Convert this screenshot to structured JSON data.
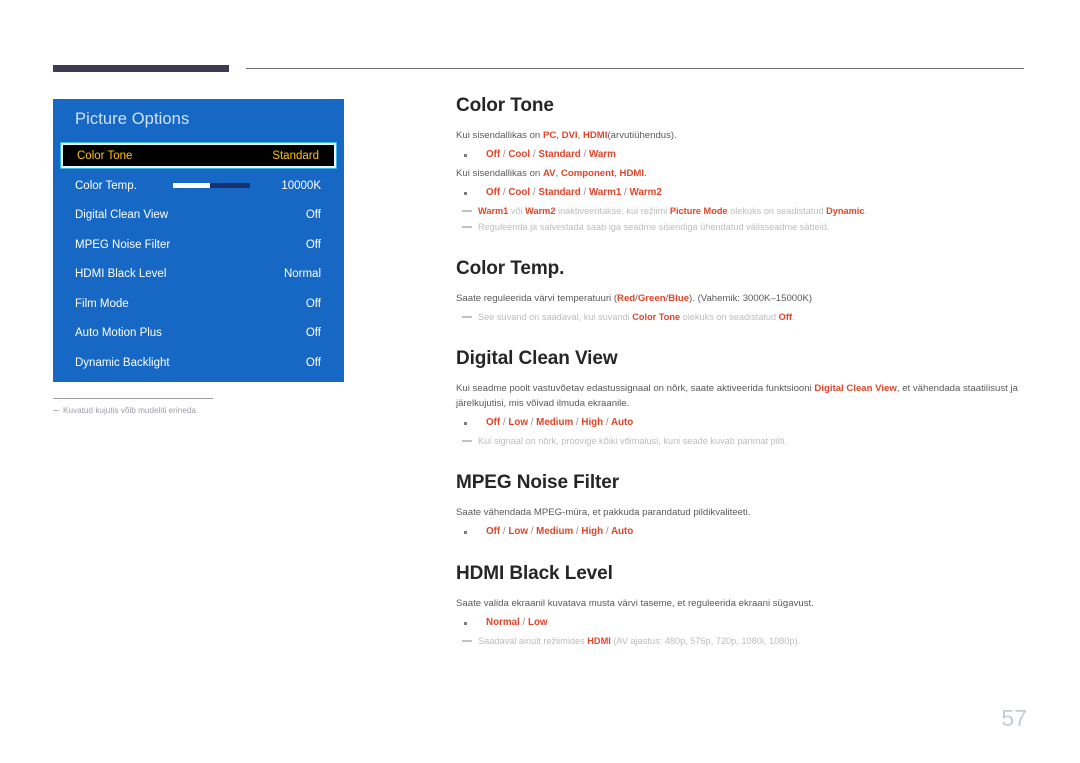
{
  "page": {
    "number": "57"
  },
  "osd": {
    "title": "Picture Options",
    "rows": [
      {
        "label": "Color Tone",
        "value": "Standard",
        "selected": true,
        "slider": false
      },
      {
        "label": "Color Temp.",
        "value": "10000K",
        "selected": false,
        "slider": true
      },
      {
        "label": "Digital Clean View",
        "value": "Off",
        "selected": false,
        "slider": false
      },
      {
        "label": "MPEG Noise Filter",
        "value": "Off",
        "selected": false,
        "slider": false
      },
      {
        "label": "HDMI Black Level",
        "value": "Normal",
        "selected": false,
        "slider": false
      },
      {
        "label": "Film Mode",
        "value": "Off",
        "selected": false,
        "slider": false
      },
      {
        "label": "Auto Motion Plus",
        "value": "Off",
        "selected": false,
        "slider": false
      },
      {
        "label": "Dynamic Backlight",
        "value": "Off",
        "selected": false,
        "slider": false
      }
    ],
    "footnote": "Kuvatud kujutis võib mudeliti erineda."
  },
  "sections": [
    {
      "title": "Color Tone",
      "blocks": [
        {
          "type": "para",
          "html": "Kui sisendallikas on <b>PC</b>, <b>DVI</b>, <b>HDMI</b>(arvutiühendus)."
        },
        {
          "type": "opts",
          "html": "<span class=\"o\">Off</span> <span class=\"sl\">/</span> <span class=\"o\">Cool</span> <span class=\"sl\">/</span> <span class=\"o\">Standard</span> <span class=\"sl\">/</span> <span class=\"o\">Warm</span>"
        },
        {
          "type": "para",
          "html": "Kui sisendallikas on <b>AV</b>, <b>Component</b>, <b>HDMI</b>."
        },
        {
          "type": "opts",
          "html": "<span class=\"o\">Off</span> <span class=\"sl\">/</span> <span class=\"o\">Cool</span> <span class=\"sl\">/</span> <span class=\"o\">Standard</span> <span class=\"sl\">/</span> <span class=\"o\">Warm1</span> <span class=\"sl\">/</span> <span class=\"o\">Warm2</span>"
        },
        {
          "type": "note",
          "html": "<b>Warm1</b> <span class=\"dim\">või</span> <b>Warm2</b> <span class=\"dim\">inaktiveeritakse, kui režiimi</span> <b>Picture Mode</b> <span class=\"dim\">olekuks on seadistatud</span> <b>Dynamic</b><span class=\"dim\">.</span>"
        },
        {
          "type": "note",
          "html": "<span class=\"dim\">Reguleerida ja salvestada saab iga seadme sisendiga ühendatud välisseadme sätteid.</span>"
        }
      ]
    },
    {
      "title": "Color Temp.",
      "blocks": [
        {
          "type": "para",
          "html": "Saate reguleerida värvi temperatuuri (<b>Red</b>/<b>Green</b>/<b>Blue</b>). (Vahemik: 3000K–15000K)"
        },
        {
          "type": "note",
          "html": "<span class=\"dim\">See suvand on saadaval, kui suvandi</span> <b>Color Tone</b> <span class=\"dim\">olekuks on seadistatud</span> <b>Off</b><span class=\"dim\">.</span>"
        }
      ]
    },
    {
      "title": "Digital Clean View",
      "blocks": [
        {
          "type": "para",
          "html": "Kui seadme poolt vastuvõetav edastussignaal on nõrk, saate aktiveerida funktsiooni <b>Digital Clean View</b>, et vähendada staatilisust ja järelkujutisi, mis võivad ilmuda ekraanile."
        },
        {
          "type": "opts",
          "html": "<span class=\"o\">Off</span> <span class=\"sl\">/</span> <span class=\"o\">Low</span> <span class=\"sl\">/</span> <span class=\"o\">Medium</span> <span class=\"sl\">/</span> <span class=\"o\">High</span> <span class=\"sl\">/</span> <span class=\"o\">Auto</span>"
        },
        {
          "type": "note",
          "html": "<span class=\"dim\">Kui signaal on nõrk, proovige kõiki võimalusi, kuni seade kuvab parimat pilti.</span>"
        }
      ]
    },
    {
      "title": "MPEG Noise Filter",
      "blocks": [
        {
          "type": "para",
          "html": "Saate vähendada MPEG-müra, et pakkuda parandatud pildikvaliteeti."
        },
        {
          "type": "opts",
          "html": "<span class=\"o\">Off</span> <span class=\"sl\">/</span> <span class=\"o\">Low</span> <span class=\"sl\">/</span> <span class=\"o\">Medium</span> <span class=\"sl\">/</span> <span class=\"o\">High</span> <span class=\"sl\">/</span> <span class=\"o\">Auto</span>"
        }
      ]
    },
    {
      "title": "HDMI Black Level",
      "blocks": [
        {
          "type": "para",
          "html": "Saate valida ekraanil kuvatava musta värvi taseme, et reguleerida ekraani sügavust."
        },
        {
          "type": "opts",
          "html": "<span class=\"o\">Normal</span> <span class=\"sl\">/</span> <span class=\"o\">Low</span>"
        },
        {
          "type": "note",
          "html": "<span class=\"dim\">Saadaval ainult režiimides</span> <b>HDMI</b> <span class=\"dim\">(AV ajastus: 480p, 576p, 720p, 1080i, 1080p).</span>"
        }
      ]
    }
  ]
}
